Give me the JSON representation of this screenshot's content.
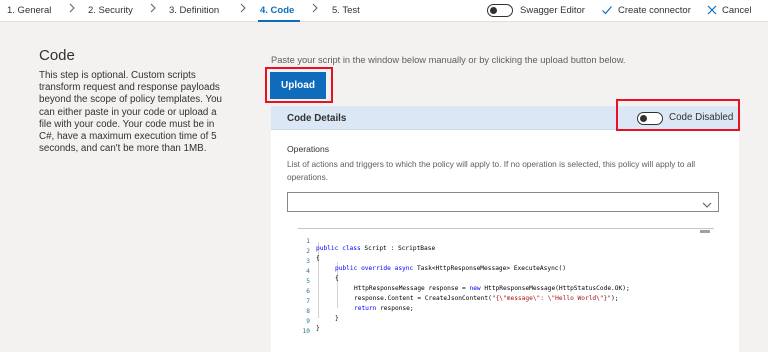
{
  "steps": [
    {
      "label": "1. General"
    },
    {
      "label": "2. Security"
    },
    {
      "label": "3. Definition"
    },
    {
      "label": "4. Code"
    },
    {
      "label": "5. Test"
    }
  ],
  "top_actions": {
    "swagger_label": "Swagger Editor",
    "create_label": "Create connector",
    "cancel_label": "Cancel"
  },
  "left": {
    "title": "Code",
    "description": "This step is optional. Custom scripts transform request and response payloads beyond the scope of policy templates. You can either paste in your code or upload a file with your code. Your code must be in C#, have a maximum execution time of 5 seconds, and can't be more than 1MB."
  },
  "main": {
    "instruction": "Paste your script in the window below manually or by clicking the upload button below.",
    "upload_label": "Upload",
    "panel_title": "Code Details",
    "code_toggle_label": "Code Disabled",
    "operations_label": "Operations",
    "operations_desc": "List of actions and triggers to which the policy will apply to. If no operation is selected, this policy will apply to all operations.",
    "operations_value": ""
  },
  "code": {
    "line_numbers": [
      "1",
      "2",
      "3",
      "4",
      "5",
      "6",
      "7",
      "8",
      "9",
      "10"
    ],
    "l1_kw": "public class",
    "l1_name": " Script : ScriptBase",
    "l2": "{",
    "l3_kw": "public override async",
    "l3_rest": " Task<HttpResponseMessage> ExecuteAsync()",
    "l4": "{",
    "l5_a": "HttpResponseMessage response = ",
    "l5_kw": "new",
    "l5_b": " HttpResponseMessage(HttpStatusCode.OK);",
    "l6_a": "response.Content = CreateJsonContent(",
    "l6_str": "\"{\\\"message\\\": \\\"Hello World\\\"}\"",
    "l6_b": ");",
    "l7_kw": "return",
    "l7_rest": " response;",
    "l8": "}",
    "l9": "}",
    "l10": ""
  },
  "colors": {
    "accent": "#0f6cbd",
    "highlight_box": "#e81123",
    "panel_header": "#dbe7f5"
  }
}
